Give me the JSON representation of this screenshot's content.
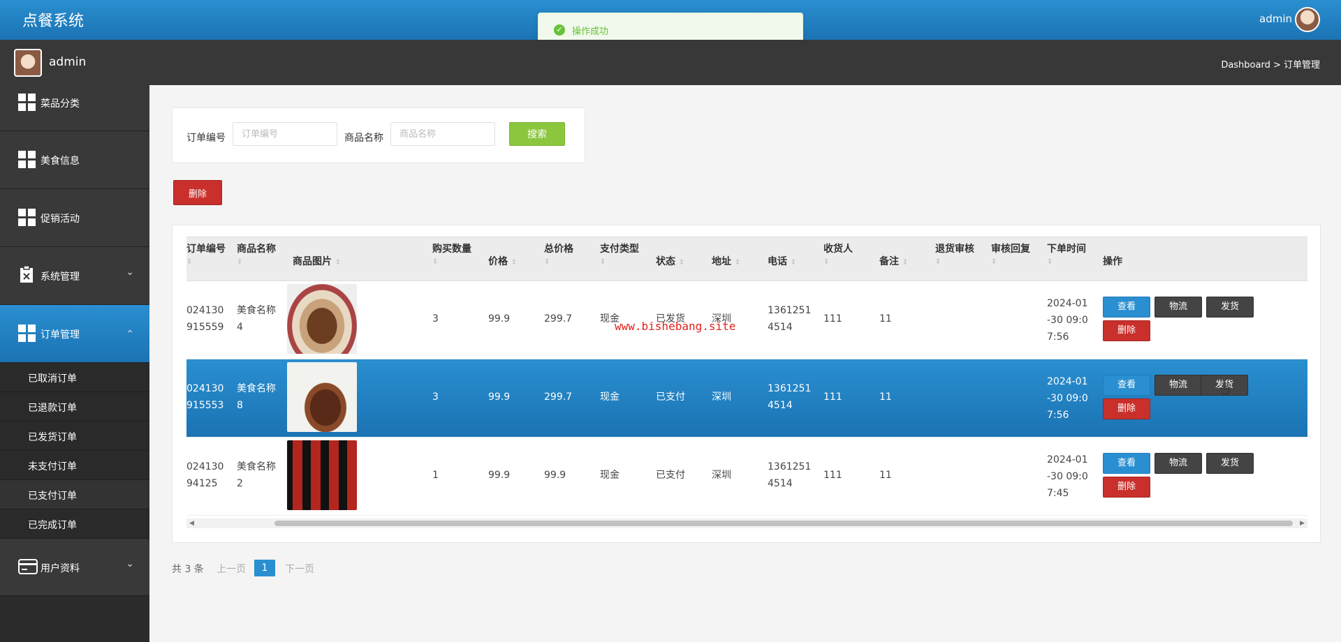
{
  "app": {
    "title": "点餐系统",
    "admin_user": "admin"
  },
  "toast": {
    "message": "操作成功"
  },
  "subbar": {
    "username": "admin",
    "breadcrumb": "Dashboard > 订单管理"
  },
  "sidebar": {
    "items": [
      {
        "label": "菜品分类",
        "icon": "grid-icon"
      },
      {
        "label": "美食信息",
        "icon": "grid-icon"
      },
      {
        "label": "促销活动",
        "icon": "grid-icon"
      },
      {
        "label": "系统管理",
        "icon": "clipboard-icon",
        "chevron": "⌄"
      },
      {
        "label": "订单管理",
        "icon": "grid-icon",
        "chevron": "⌃"
      },
      {
        "label": "用户资料",
        "icon": "card-icon",
        "chevron": "⌄"
      }
    ],
    "subitems": [
      "已取消订单",
      "已退款订单",
      "已发货订单",
      "未支付订单",
      "已支付订单",
      "已完成订单"
    ]
  },
  "search": {
    "order_label": "订单编号",
    "order_placeholder": "订单编号",
    "goods_label": "商品名称",
    "goods_placeholder": "商品名称",
    "button": "搜索"
  },
  "delete_button": "删除",
  "table": {
    "headers": [
      "订单编号",
      "商品名称",
      "商品图片",
      "购买数量",
      "价格",
      "总价格",
      "支付类型",
      "状态",
      "地址",
      "电话",
      "收货人",
      "备注",
      "退货审核",
      "审核回复",
      "下单时间",
      "操作"
    ],
    "sort_glyph": "⇕",
    "rows": [
      {
        "order_no_1": "024130",
        "order_no_2": "915559",
        "name_1": "美食名称",
        "name_2": "4",
        "qty": "3",
        "price": "99.9",
        "total": "299.7",
        "pay": "现金",
        "status": "已发货",
        "addr": "深圳",
        "phone_1": "1361251",
        "phone_2": "4514",
        "receiver": "111",
        "remark": "11",
        "time_1": "2024-01",
        "time_2": "-30 09:0",
        "time_3": "7:56"
      },
      {
        "order_no_1": "024130",
        "order_no_2": "915553",
        "name_1": "美食名称",
        "name_2": "8",
        "qty": "3",
        "price": "99.9",
        "total": "299.7",
        "pay": "现金",
        "status": "已支付",
        "addr": "深圳",
        "phone_1": "1361251",
        "phone_2": "4514",
        "receiver": "111",
        "remark": "11",
        "time_1": "2024-01",
        "time_2": "-30 09:0",
        "time_3": "7:56"
      },
      {
        "order_no_1": "024130",
        "order_no_2": "94125",
        "name_1": "美食名称",
        "name_2": "2",
        "qty": "1",
        "price": "99.9",
        "total": "99.9",
        "pay": "现金",
        "status": "已支付",
        "addr": "深圳",
        "phone_1": "1361251",
        "phone_2": "4514",
        "receiver": "111",
        "remark": "11",
        "time_1": "2024-01",
        "time_2": "-30 09:0",
        "time_3": "7:45"
      }
    ],
    "actions": {
      "view": "查看",
      "logistics": "物流",
      "ship": "发货",
      "delete": "删除"
    }
  },
  "pager": {
    "total": "共 3 条",
    "prev": "上一页",
    "current": "1",
    "next": "下一页"
  },
  "watermark": "www.bishebang.site",
  "colors": {
    "primary": "#2a8fd0",
    "sidebar": "#393939",
    "danger": "#c9302c",
    "success": "#8cc63f"
  }
}
